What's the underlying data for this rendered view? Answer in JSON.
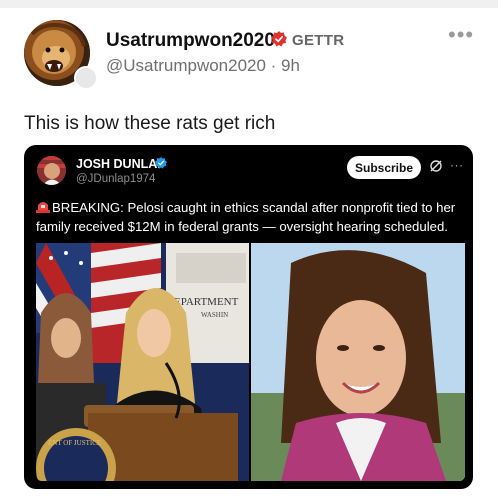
{
  "post": {
    "author_name": "Usatrumpwon2020",
    "site_tag": "GETTR",
    "handle_time": "@Usatrumpwon2020 · 9h",
    "more_label": "•••",
    "text": "This is how these rats get rich"
  },
  "embedded": {
    "author_name": "JOSH DUNLAP",
    "handle": "@JDunlap1974",
    "subscribe_label": "Subscribe",
    "more_label": "···",
    "headline": "BREAKING: Pelosi caught in ethics scandal after nonprofit tied to her family received $12M in federal grants — oversight hearing scheduled.",
    "left_photo_sign_1": "EPARTMENT",
    "left_photo_sign_2": "WASHIN",
    "left_photo_seal": "ENT OF JUSTICE"
  },
  "colors": {
    "verified": "#e0322c",
    "card_bg": "#000000",
    "embedded_verified": "#1d9bf0"
  },
  "icons": [
    "lion-avatar",
    "verified-check-icon",
    "more-icon",
    "verified-blue-icon",
    "grok-icon",
    "siren-icon"
  ]
}
